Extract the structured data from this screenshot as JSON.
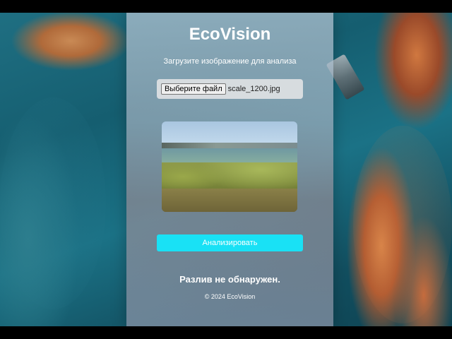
{
  "app": {
    "title": "EcoVision",
    "subtitle": "Загрузите изображение для анализа"
  },
  "upload": {
    "button_label": "Выберите файл",
    "file_name": "scale_1200.jpg"
  },
  "actions": {
    "analyze_label": "Анализировать"
  },
  "result": {
    "text": "Разлив не обнаружен."
  },
  "footer": {
    "text": "© 2024 EcoVision"
  },
  "colors": {
    "accent": "#19e1f5",
    "text": "#ffffff"
  }
}
